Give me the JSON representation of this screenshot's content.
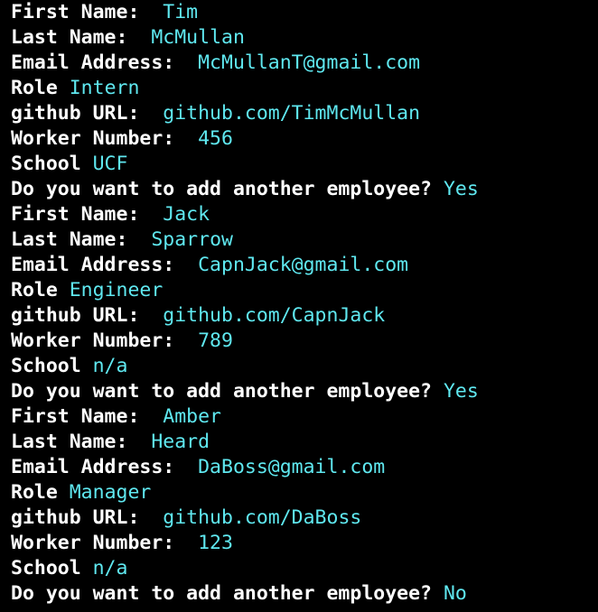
{
  "terminal": {
    "lines": [
      {
        "prompt": "First Name:  ",
        "answer": "Tim"
      },
      {
        "prompt": "Last Name:  ",
        "answer": "McMullan"
      },
      {
        "prompt": "Email Address:  ",
        "answer": "McMullanT@gmail.com"
      },
      {
        "prompt": "Role ",
        "answer": "Intern"
      },
      {
        "prompt": "github URL:  ",
        "answer": "github.com/TimMcMullan"
      },
      {
        "prompt": "Worker Number:  ",
        "answer": "456"
      },
      {
        "prompt": "School ",
        "answer": "UCF"
      },
      {
        "prompt": "Do you want to add another employee? ",
        "answer": "Yes"
      },
      {
        "prompt": "First Name:  ",
        "answer": "Jack"
      },
      {
        "prompt": "Last Name:  ",
        "answer": "Sparrow"
      },
      {
        "prompt": "Email Address:  ",
        "answer": "CapnJack@gmail.com"
      },
      {
        "prompt": "Role ",
        "answer": "Engineer"
      },
      {
        "prompt": "github URL:  ",
        "answer": "github.com/CapnJack"
      },
      {
        "prompt": "Worker Number:  ",
        "answer": "789"
      },
      {
        "prompt": "School ",
        "answer": "n/a"
      },
      {
        "prompt": "Do you want to add another employee? ",
        "answer": "Yes"
      },
      {
        "prompt": "First Name:  ",
        "answer": "Amber"
      },
      {
        "prompt": "Last Name:  ",
        "answer": "Heard"
      },
      {
        "prompt": "Email Address:  ",
        "answer": "DaBoss@gmail.com"
      },
      {
        "prompt": "Role ",
        "answer": "Manager"
      },
      {
        "prompt": "github URL:  ",
        "answer": "github.com/DaBoss"
      },
      {
        "prompt": "Worker Number:  ",
        "answer": "123"
      },
      {
        "prompt": "School ",
        "answer": "n/a"
      },
      {
        "prompt": "Do you want to add another employee? ",
        "answer": "No"
      }
    ]
  },
  "colors": {
    "background": "#000000",
    "prompt_text": "#ffffff",
    "answer_text": "#5fe8f0"
  }
}
